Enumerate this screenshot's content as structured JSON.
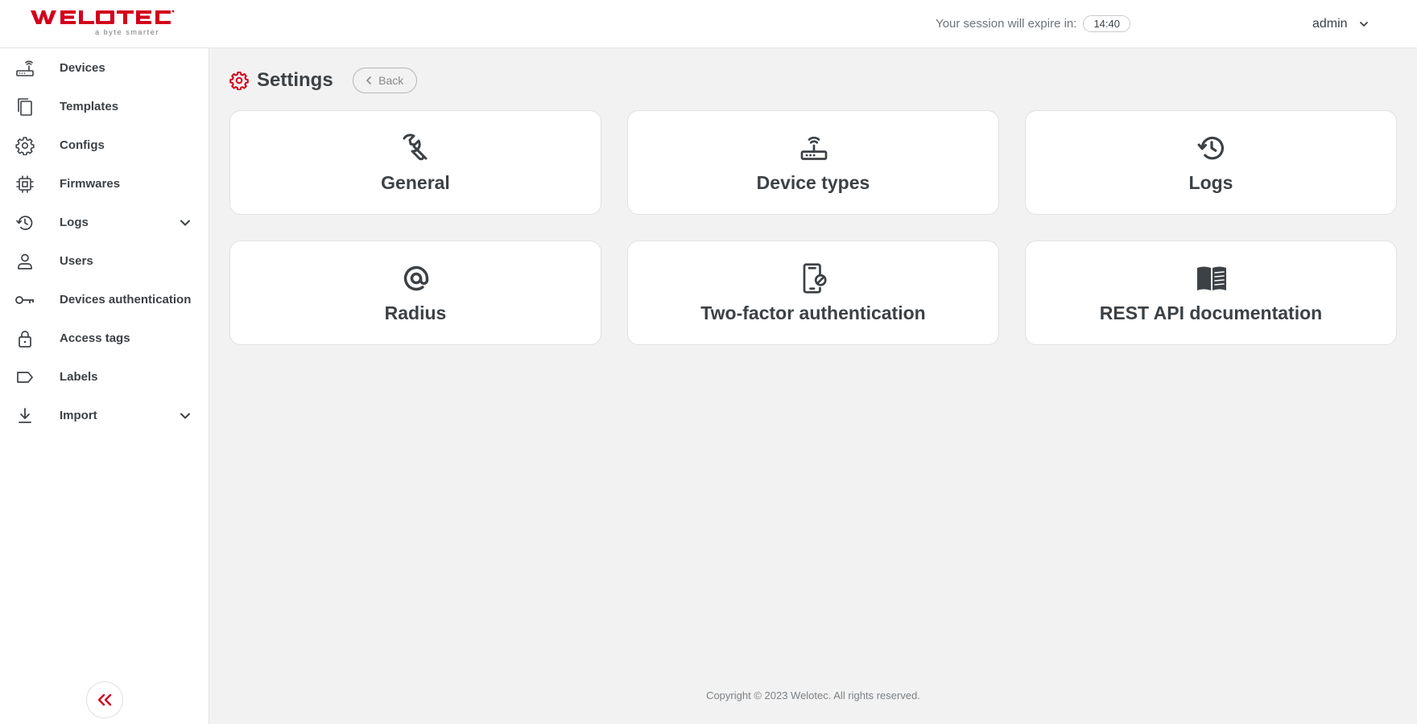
{
  "brand": {
    "name": "WELOTEC",
    "tagline": "a byte smarter",
    "accent_color": "#d3001c"
  },
  "header": {
    "session_label": "Your session will expire in:",
    "session_timer": "14:40",
    "user_name": "admin",
    "user_menu_icon": "chevron-down-icon"
  },
  "sidebar": {
    "items": [
      {
        "label": "Devices",
        "icon": "router-icon"
      },
      {
        "label": "Templates",
        "icon": "copy-icon"
      },
      {
        "label": "Configs",
        "icon": "gear-icon"
      },
      {
        "label": "Firmwares",
        "icon": "chip-icon"
      },
      {
        "label": "Logs",
        "icon": "history-icon",
        "expandable": true
      },
      {
        "label": "Users",
        "icon": "person-icon"
      },
      {
        "label": "Devices authentication",
        "icon": "key-icon"
      },
      {
        "label": "Access tags",
        "icon": "lock-icon"
      },
      {
        "label": "Labels",
        "icon": "label-icon"
      },
      {
        "label": "Import",
        "icon": "download-icon",
        "expandable": true
      }
    ],
    "collapse_icon": "double-chevron-left-icon"
  },
  "page": {
    "title": "Settings",
    "title_icon": "gear-icon",
    "back_label": "Back"
  },
  "cards": [
    {
      "label": "General",
      "icon": "wrench-icon"
    },
    {
      "label": "Device types",
      "icon": "router-icon"
    },
    {
      "label": "Logs",
      "icon": "history-icon"
    },
    {
      "label": "Radius",
      "icon": "at-sign-icon"
    },
    {
      "label": "Two-factor authentication",
      "icon": "phone-lock-icon"
    },
    {
      "label": "REST API documentation",
      "icon": "book-icon"
    }
  ],
  "footer": {
    "copyright": "Copyright © 2023 Welotec. All rights reserved."
  }
}
